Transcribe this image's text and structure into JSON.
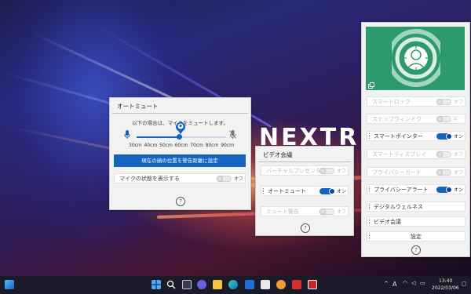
{
  "wallpaper": {
    "brand_text": "NEXTR"
  },
  "auto_mute": {
    "title": "オートミュート",
    "info": "以下の場合は、マイクをミュートします。",
    "distances": [
      "30cm",
      "40cm",
      "50cm",
      "60cm",
      "70cm",
      "80cm",
      "90cm"
    ],
    "slider_value": "60cm",
    "set_button": "現在の顔の位置を警告距離に設定",
    "show_mic_label": "マイクの状態を表示する",
    "show_mic_state": "オフ",
    "help": "?"
  },
  "video_conf": {
    "title": "ビデオ会議",
    "rows": [
      {
        "label": "バーチャルプレゼンター",
        "state": "オフ",
        "on": false,
        "dim": true
      },
      {
        "label": "オートミュート",
        "state": "オン",
        "on": true,
        "dim": false
      },
      {
        "label": "ミュート警告",
        "state": "オフ",
        "on": false,
        "dim": true
      }
    ],
    "help": "?"
  },
  "side_panel": {
    "rows": [
      {
        "label": "スマートロック",
        "state": "オフ",
        "on": false,
        "dim": true
      },
      {
        "label": "スナップウィンドウ",
        "state": "",
        "on": false,
        "dim": true
      },
      {
        "label": "スマートポインター",
        "state": "オン",
        "on": true,
        "dim": false
      },
      {
        "label": "スマートディスプレイ",
        "state": "オフ",
        "on": false,
        "dim": true
      },
      {
        "label": "プライバシーガード",
        "state": "オフ",
        "on": false,
        "dim": true
      },
      {
        "label": "プライバシーアラート",
        "state": "オン",
        "on": true,
        "dim": false
      }
    ],
    "links": [
      "デジタルウェルネス",
      "ビデオ会議"
    ],
    "settings": "設定",
    "help": "?"
  },
  "taskbar": {
    "time": "13:40",
    "date": "2022/03/06",
    "ime": "A",
    "colors": {
      "bar": "#1a1a28",
      "accent": "#1565c0"
    }
  }
}
